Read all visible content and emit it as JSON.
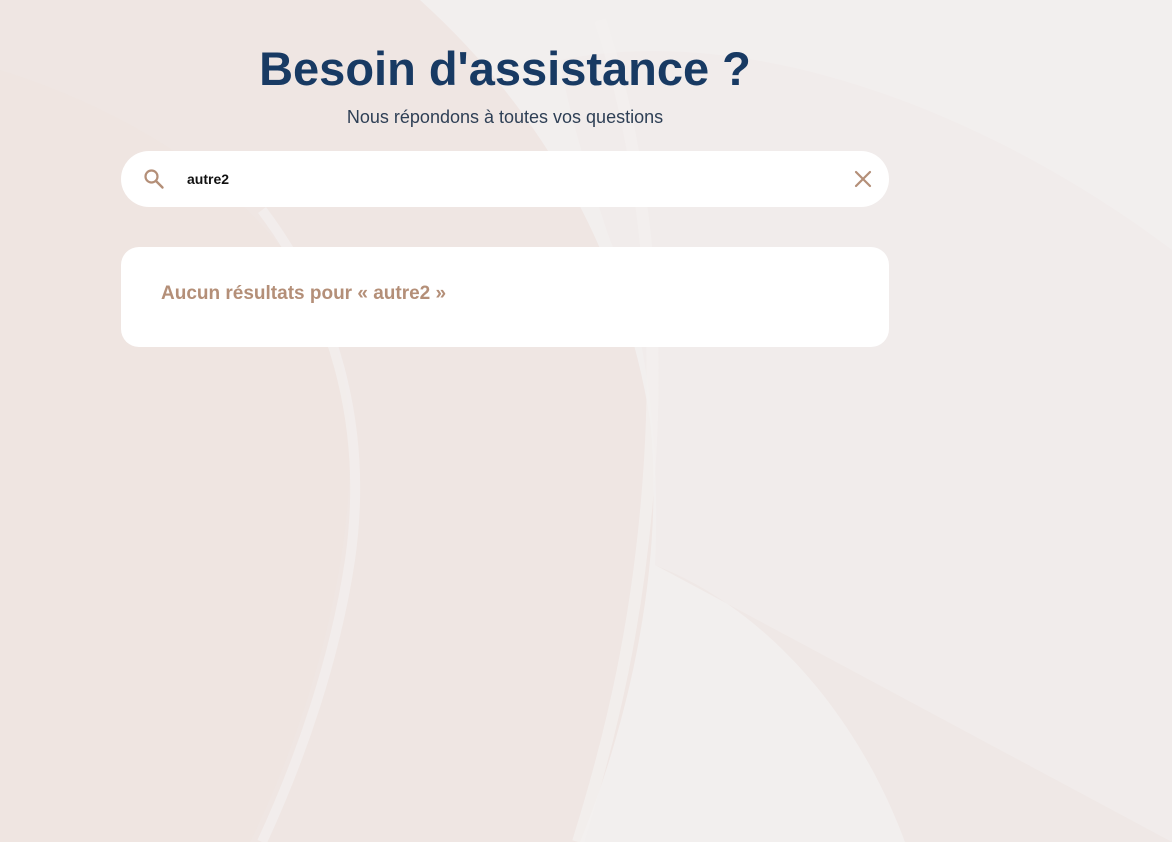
{
  "header": {
    "title": "Besoin d'assistance ?",
    "subtitle": "Nous répondons à toutes vos questions"
  },
  "search": {
    "icon": "search-icon",
    "value": "autre2",
    "clear_icon": "close-icon"
  },
  "results": {
    "empty_message": "Aucun résultats pour « autre2 »"
  },
  "colors": {
    "background": "#efe6e3",
    "title": "#183a63",
    "subtitle": "#2e3f55",
    "accent": "#b48f78",
    "card": "#ffffff"
  }
}
